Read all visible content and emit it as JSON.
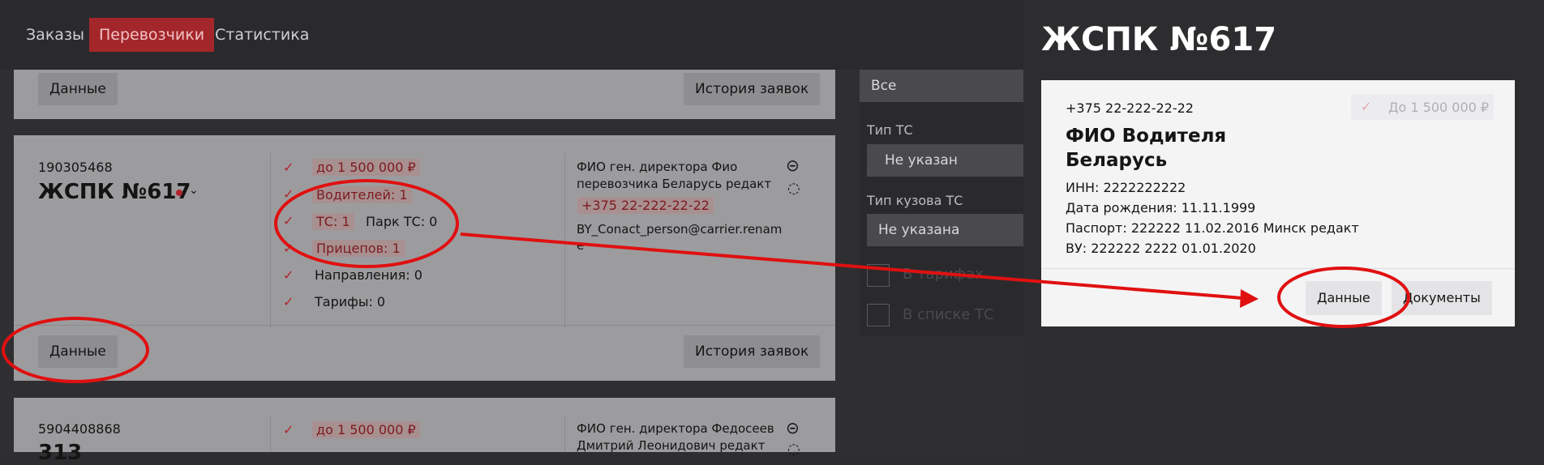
{
  "nav": {
    "orders": "Заказы",
    "carriers": "Перевозчики",
    "stats": "Статистика"
  },
  "cards": [
    {
      "buttons": {
        "data": "Данные",
        "history": "История заявок"
      }
    },
    {
      "id": "190305468",
      "name": "ЖСПК №617",
      "stats": {
        "limit": "до 1 500 000 ₽",
        "drivers": "Водителей: 1",
        "vehicles": "ТС: 1",
        "park": "Парк ТС: 0",
        "trailers": "Прицепов: 1",
        "directions": "Направления: 0",
        "tariffs": "Тарифы: 0"
      },
      "contact": {
        "director_line1": "ФИО ген. директора Фио",
        "director_line2": "перевозчика Беларусь редакт",
        "phone": "+375 22-222-22-22",
        "email_line1": "BY_Conact_person@carrier.renam",
        "email_line2": "e"
      },
      "buttons": {
        "data": "Данные",
        "history": "История заявок"
      }
    },
    {
      "id": "5904408868",
      "name": "313",
      "stats": {
        "limit": "до 1 500 000 ₽"
      },
      "contact": {
        "director_line1": "ФИО ген. директора Федосеев",
        "director_line2": "Дмитрий Леонидович редакт"
      }
    }
  ],
  "filters": {
    "all": "Все",
    "vehicle_type_label": "Тип ТС",
    "vehicle_type_value": "Не указан",
    "body_type_label": "Тип кузова ТС",
    "body_type_value": "Не указана",
    "check1": "В тарифах",
    "check2": "В списке ТС"
  },
  "drawer": {
    "title": "ЖСПК №617",
    "phone": "+375 22-222-22-22",
    "limit_badge": "До 1 500 000 ₽",
    "driver_name_line1": "ФИО Водителя",
    "driver_name_line2": "Беларусь",
    "inn": "ИНН: 2222222222",
    "birth": "Дата рождения: 11.11.1999",
    "passport": "Паспорт: 222222 11.02.2016 Минск редакт",
    "license": "ВУ: 222222 2222 01.01.2020",
    "btn_data": "Данные",
    "btn_docs": "Документы"
  },
  "colors": {
    "accent": "#a3262b",
    "annotation": "#e01010"
  }
}
